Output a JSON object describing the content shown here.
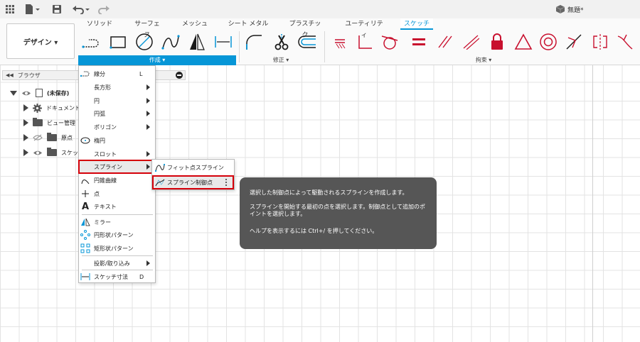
{
  "document": {
    "title": "無題*"
  },
  "ribbon": {
    "tabs": [
      {
        "label": "ソリッド",
        "active": false
      },
      {
        "label": "サーフェス",
        "active": false
      },
      {
        "label": "メッシュ",
        "active": false
      },
      {
        "label": "シート メタル",
        "active": false
      },
      {
        "label": "プラスチック",
        "active": false
      },
      {
        "label": "ユーティリティ",
        "active": false
      },
      {
        "label": "スケッチ",
        "active": true
      }
    ],
    "workspace_button": "デザイン ▾",
    "groups": {
      "create": "作成 ▾",
      "modify": "修正 ▾",
      "constraints": "拘束 ▾"
    }
  },
  "browser": {
    "title": "ブラウザ",
    "items": [
      {
        "label": "(未保存)",
        "expanded": true
      },
      {
        "label": "ドキュメント"
      },
      {
        "label": "ビュー管理"
      },
      {
        "label": "原点"
      },
      {
        "label": "スケッチ"
      }
    ]
  },
  "create_menu": {
    "items": [
      {
        "label": "線分",
        "shortcut": "L",
        "icon": "line-icon"
      },
      {
        "label": "長方形",
        "submenu": true
      },
      {
        "label": "円",
        "submenu": true
      },
      {
        "label": "円弧",
        "submenu": true
      },
      {
        "label": "ポリゴン",
        "submenu": true
      },
      {
        "label": "楕円",
        "icon": "ellipse-icon"
      },
      {
        "label": "スロット",
        "submenu": true
      },
      {
        "label": "スプライン",
        "submenu": true,
        "highlighted": true
      },
      {
        "label": "円錐曲線",
        "icon": "conic-icon"
      },
      {
        "label": "点",
        "icon": "point-icon"
      },
      {
        "label": "テキスト",
        "icon": "text-icon"
      },
      {
        "label": "ミラー",
        "icon": "mirror-icon"
      },
      {
        "label": "円形状パターン",
        "icon": "circular-pattern-icon"
      },
      {
        "label": "矩形状パターン",
        "icon": "rectangular-pattern-icon"
      },
      {
        "label": "投影/取り込み",
        "submenu": true
      },
      {
        "label": "スケッチ寸法",
        "shortcut": "D",
        "icon": "dimension-icon"
      }
    ]
  },
  "spline_submenu": {
    "items": [
      {
        "label": "フィット点スプライン"
      },
      {
        "label": "スプライン制御点",
        "highlighted": true
      }
    ]
  },
  "tooltip": {
    "line1": "選択した制御点によって駆動されるスプラインを作成します。",
    "line2": "スプラインを開始する最初の点を選択します。制御点として追加のポイントを選択します。",
    "line3": "ヘルプを表示するには Ctrl+/ を押してください。"
  }
}
